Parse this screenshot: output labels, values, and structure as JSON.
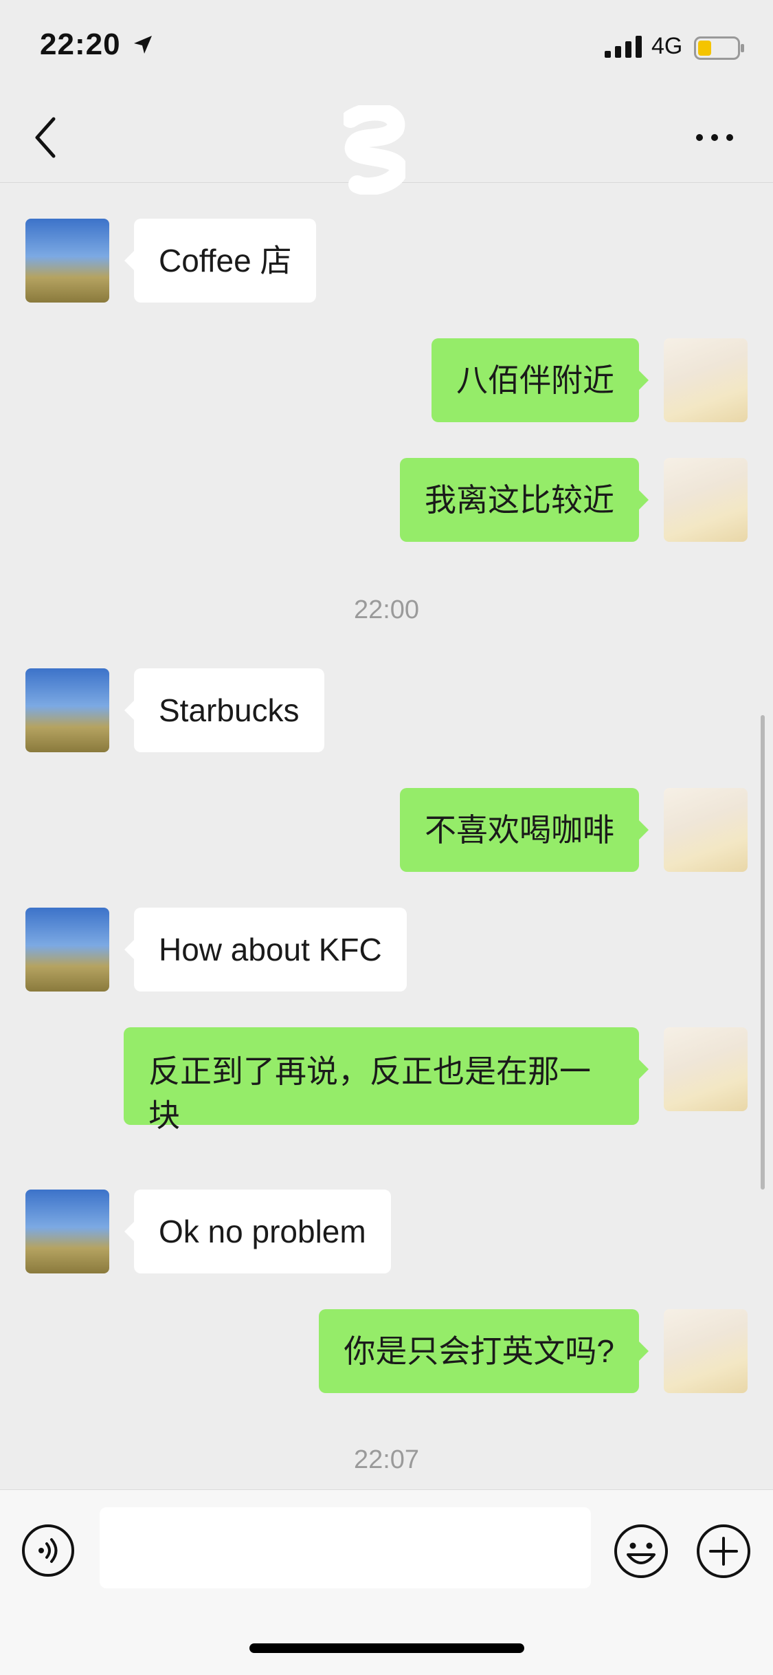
{
  "status_bar": {
    "time": "22:20",
    "network": "4G",
    "battery_level": 0.35,
    "icons": [
      "location-arrow-icon",
      "signal-bars-icon",
      "battery-icon"
    ]
  },
  "nav": {
    "back_icon": "chevron-left-icon",
    "more_icon": "more-dots-icon"
  },
  "messages": [
    {
      "side": "left",
      "text": "Coffee 店"
    },
    {
      "side": "right",
      "text": "八佰伴附近"
    },
    {
      "side": "right",
      "text": "我离这比较近"
    },
    {
      "timestamp": "22:00"
    },
    {
      "side": "left",
      "text": "Starbucks"
    },
    {
      "side": "right",
      "text": "不喜欢喝咖啡"
    },
    {
      "side": "left",
      "text": "How about KFC"
    },
    {
      "side": "right",
      "text": "反正到了再说，反正也是在那一块"
    },
    {
      "side": "left",
      "text": "Ok no problem"
    },
    {
      "side": "right",
      "text": "你是只会打英文吗?"
    },
    {
      "timestamp": "22:07"
    }
  ],
  "input_bar": {
    "voice_icon": "voice-icon",
    "emoji_icon": "emoji-icon",
    "plus_icon": "plus-icon",
    "input_value": ""
  },
  "colors": {
    "background": "#ededed",
    "sent_bubble": "#95ec69",
    "received_bubble": "#ffffff",
    "timestamp_text": "#9a9a9a",
    "battery_fill": "#f5c400"
  }
}
